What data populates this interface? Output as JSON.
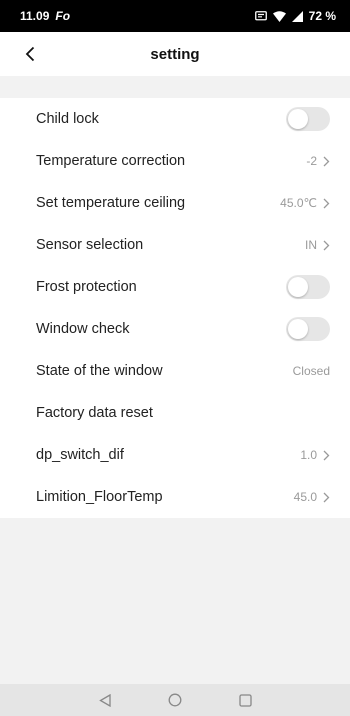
{
  "status_bar": {
    "time": "11.09",
    "app_icon": "Fo",
    "battery": "72 %",
    "icons": [
      "message-icon",
      "wifi-icon",
      "signal-icon"
    ]
  },
  "header": {
    "back_icon": "chevron-left-icon",
    "title": "setting"
  },
  "settings": [
    {
      "label": "Child lock",
      "type": "toggle",
      "on": false
    },
    {
      "label": "Temperature correction",
      "type": "value",
      "value": "-2"
    },
    {
      "label": "Set temperature ceiling",
      "type": "value",
      "value": "45.0℃"
    },
    {
      "label": "Sensor selection",
      "type": "value",
      "value": "IN"
    },
    {
      "label": "Frost protection",
      "type": "toggle",
      "on": false
    },
    {
      "label": "Window check",
      "type": "toggle",
      "on": false
    },
    {
      "label": "State of the window",
      "type": "text",
      "value": "Closed"
    },
    {
      "label": "Factory data reset",
      "type": "action"
    },
    {
      "label": "dp_switch_dif",
      "type": "value",
      "value": "1.0"
    },
    {
      "label": "Limition_FloorTemp",
      "type": "value",
      "value": "45.0"
    }
  ],
  "nav_bar": {
    "buttons": [
      "back-triangle-icon",
      "home-circle-icon",
      "recents-square-icon"
    ]
  },
  "colors": {
    "status_bar_bg": "#000000",
    "page_bg": "#f2f2f2",
    "row_bg": "#ffffff",
    "toggle_off": "#e6e6e6",
    "secondary_text": "#9a9a9a"
  }
}
